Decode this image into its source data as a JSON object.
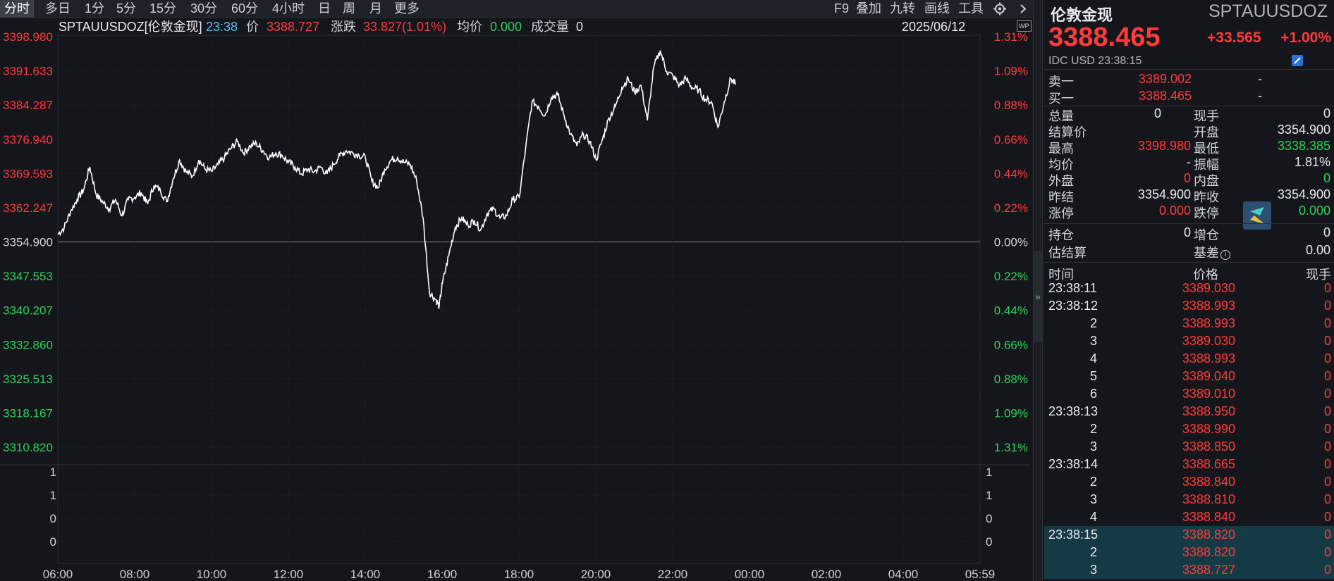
{
  "toolbar": {
    "periods": [
      "分时",
      "多日",
      "1分",
      "5分",
      "15分",
      "30分",
      "60分",
      "4小时",
      "日",
      "周",
      "月",
      "更多"
    ],
    "active_period": "分时",
    "tools": [
      "F9",
      "叠加",
      "九转",
      "画线",
      "工具"
    ],
    "gear_icon": "gear-icon",
    "more_icon": "chevron-right-icon"
  },
  "infoline": {
    "symbol": "SPTAUUSDOZ[伦敦金现]",
    "time": "23:38",
    "price_label": "价",
    "price": "3388.727",
    "change_label": "涨跌",
    "change": "33.827(1.01%)",
    "avg_label": "均价",
    "avg": "0.000",
    "volume_label": "成交量",
    "volume": "0",
    "date": "2025/06/12",
    "corner_badge": "WP"
  },
  "colors": {
    "up": "#ff3b3b",
    "down": "#2fd05a",
    "line": "#ffffff",
    "background": "#14161b"
  },
  "chart_data": {
    "type": "line",
    "title": "",
    "xlabel": "",
    "ylabel": "",
    "prev_close": 3354.9,
    "ylim": [
      3310.82,
      3398.98
    ],
    "y_ticks_left": [
      "3398.980",
      "3391.633",
      "3384.287",
      "3376.940",
      "3369.593",
      "3362.247",
      "3354.900",
      "3347.553",
      "3340.207",
      "3332.860",
      "3325.513",
      "3318.167",
      "3310.820"
    ],
    "y_ticks_right": [
      "1.31%",
      "1.09%",
      "0.88%",
      "0.66%",
      "0.44%",
      "0.22%",
      "0.00%",
      "0.22%",
      "0.44%",
      "0.66%",
      "0.88%",
      "1.09%",
      "1.31%"
    ],
    "x_ticks": [
      "06:00",
      "08:00",
      "10:00",
      "12:00",
      "14:00",
      "16:00",
      "18:00",
      "20:00",
      "22:00",
      "00:00",
      "02:00",
      "04:00",
      "05:59"
    ],
    "volume_ticks": [
      "1",
      "1",
      "0",
      "0"
    ],
    "grid": true,
    "series": [
      {
        "x": [
          "06:00",
          "06:10",
          "06:20",
          "06:30",
          "06:40",
          "06:50",
          "07:00",
          "07:10",
          "07:20",
          "07:30",
          "07:40",
          "07:50",
          "08:00",
          "08:10",
          "08:20",
          "08:30",
          "08:40",
          "08:50",
          "09:00",
          "09:10",
          "09:20",
          "09:30",
          "09:40",
          "09:50",
          "10:00",
          "10:10",
          "10:20",
          "10:30",
          "10:40",
          "10:50",
          "11:00",
          "11:10",
          "11:20",
          "11:30",
          "11:40",
          "11:50",
          "12:00",
          "12:10",
          "12:20",
          "12:30",
          "12:40",
          "12:50",
          "13:00",
          "13:10",
          "13:20",
          "13:30",
          "13:40",
          "13:50",
          "14:00",
          "14:10",
          "14:20",
          "14:30",
          "14:40",
          "14:50",
          "15:00",
          "15:10",
          "15:20",
          "15:30",
          "15:40",
          "15:50",
          "15:55",
          "16:00",
          "16:10",
          "16:20",
          "16:30",
          "16:40",
          "16:50",
          "17:00",
          "17:10",
          "17:20",
          "17:30",
          "17:40",
          "17:50",
          "18:00",
          "18:10",
          "18:20",
          "18:30",
          "18:40",
          "18:50",
          "19:00",
          "19:10",
          "19:20",
          "19:30",
          "19:40",
          "19:50",
          "20:00",
          "20:10",
          "20:20",
          "20:30",
          "20:40",
          "20:50",
          "21:00",
          "21:10",
          "21:20",
          "21:30",
          "21:40",
          "21:50",
          "22:00",
          "22:10",
          "22:20",
          "22:30",
          "22:40",
          "22:50",
          "23:00",
          "23:10",
          "23:20",
          "23:30",
          "23:38"
        ],
        "values": [
          3356.5,
          3358.0,
          3361.5,
          3364.0,
          3366.0,
          3371.0,
          3365.0,
          3363.5,
          3362.0,
          3364.0,
          3360.5,
          3364.0,
          3364.5,
          3365.5,
          3363.0,
          3367.0,
          3366.0,
          3363.5,
          3368.5,
          3372.5,
          3370.0,
          3369.0,
          3372.5,
          3370.5,
          3370.0,
          3371.5,
          3373.0,
          3375.0,
          3376.5,
          3374.0,
          3375.5,
          3376.0,
          3374.5,
          3373.0,
          3374.0,
          3373.5,
          3372.0,
          3371.0,
          3369.5,
          3370.5,
          3370.0,
          3371.0,
          3369.5,
          3371.5,
          3373.5,
          3374.5,
          3374.0,
          3373.5,
          3373.0,
          3368.0,
          3366.5,
          3370.5,
          3372.5,
          3373.0,
          3372.0,
          3371.5,
          3368.0,
          3360.0,
          3344.0,
          3342.5,
          3341.0,
          3346.0,
          3352.0,
          3358.0,
          3360.0,
          3358.5,
          3359.5,
          3357.5,
          3361.0,
          3362.0,
          3360.0,
          3360.5,
          3364.0,
          3364.5,
          3375.0,
          3385.0,
          3384.0,
          3382.0,
          3386.0,
          3386.5,
          3382.0,
          3378.0,
          3375.5,
          3378.0,
          3376.5,
          3372.5,
          3377.0,
          3381.5,
          3384.0,
          3388.0,
          3390.0,
          3387.0,
          3388.5,
          3381.0,
          3392.5,
          3396.0,
          3391.5,
          3390.5,
          3388.5,
          3390.0,
          3388.0,
          3387.5,
          3385.5,
          3385.0,
          3379.5,
          3385.0,
          3390.0,
          3388.727
        ]
      }
    ]
  },
  "panel": {
    "name": "伦敦金现",
    "code": "SPTAUUSDOZ",
    "price": "3388.465",
    "change": "+33.565",
    "change_pct": "+1.00%",
    "meta": "IDC  USD  23:38:15",
    "edit_icon": "pencil-icon",
    "ask_label": "卖一",
    "ask": "3389.002",
    "ask_vol": "-",
    "bid_label": "买一",
    "bid": "3388.465",
    "bid_vol": "-",
    "stats": {
      "total_vol_label": "总量",
      "total_vol": "0",
      "cur_vol_label": "现手",
      "cur_vol": "0",
      "settle_label": "结算价",
      "settle": "",
      "open_label": "开盘",
      "open": "3354.900",
      "high_label": "最高",
      "high": "3398.980",
      "low_label": "最低",
      "low": "3338.385",
      "avg_label": "均价",
      "avg": "-",
      "amp_label": "振幅",
      "amp": "1.81%",
      "outer_label": "外盘",
      "outer": "0",
      "inner_label": "内盘",
      "inner": "0",
      "prev_settle_label": "昨结",
      "prev_settle": "3354.900",
      "prev_close_label": "昨收",
      "prev_close": "3354.900",
      "limit_up_label": "涨停",
      "limit_up": "0.000",
      "limit_down_label": "跌停",
      "limit_down": "0.000",
      "oi_label": "持仓",
      "oi": "0",
      "oi_chg_label": "增仓",
      "oi_chg": "0",
      "est_settle_label": "估结算",
      "est_settle": "",
      "basis_label": "基差",
      "basis": "0.00"
    },
    "trades_header": {
      "time": "时间",
      "price": "价格",
      "vol": "现手"
    },
    "trades": [
      {
        "time": "23:38:11",
        "price": "3389.030",
        "vol": "0"
      },
      {
        "time": "23:38:12",
        "price": "3388.993",
        "vol": "0"
      },
      {
        "time": "2",
        "price": "3388.993",
        "vol": "0"
      },
      {
        "time": "3",
        "price": "3389.030",
        "vol": "0"
      },
      {
        "time": "4",
        "price": "3388.993",
        "vol": "0"
      },
      {
        "time": "5",
        "price": "3389.040",
        "vol": "0"
      },
      {
        "time": "6",
        "price": "3389.010",
        "vol": "0"
      },
      {
        "time": "23:38:13",
        "price": "3388.950",
        "vol": "0"
      },
      {
        "time": "2",
        "price": "3388.990",
        "vol": "0"
      },
      {
        "time": "3",
        "price": "3388.850",
        "vol": "0"
      },
      {
        "time": "23:38:14",
        "price": "3388.665",
        "vol": "0"
      },
      {
        "time": "2",
        "price": "3388.840",
        "vol": "0"
      },
      {
        "time": "3",
        "price": "3388.810",
        "vol": "0"
      },
      {
        "time": "4",
        "price": "3388.840",
        "vol": "0"
      },
      {
        "time": "23:38:15",
        "price": "3388.820",
        "vol": "0"
      },
      {
        "time": "2",
        "price": "3388.820",
        "vol": "0"
      },
      {
        "time": "3",
        "price": "3388.727",
        "vol": "0"
      }
    ]
  }
}
